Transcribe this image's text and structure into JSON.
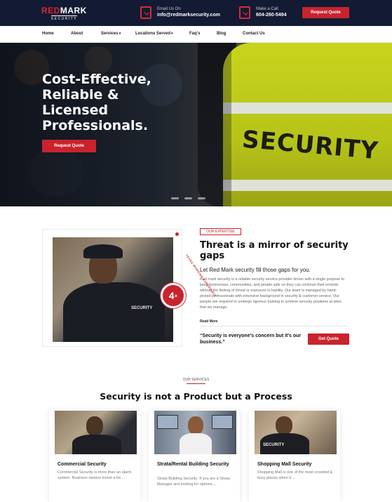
{
  "brand": {
    "name_prefix": "RED",
    "name_suffix": "MARK",
    "tagline": "SECURITY"
  },
  "header": {
    "email_label": "Email Us On",
    "email_value": "info@redmarksecurity.com",
    "call_label": "Make a Call",
    "call_value": "604-260-5494",
    "quote_button": "Request Quote"
  },
  "nav": {
    "items": [
      {
        "label": "Home"
      },
      {
        "label": "About"
      },
      {
        "label": "Services",
        "dropdown": true
      },
      {
        "label": "Locations Served",
        "dropdown": true
      },
      {
        "label": "Faq's"
      },
      {
        "label": "Blog"
      },
      {
        "label": "Contact Us"
      }
    ]
  },
  "hero": {
    "title": "Cost-Effective, Reliable & Licensed Professionals.",
    "button": "Request Quote",
    "image_text": "SECURITY",
    "slides": 3
  },
  "about": {
    "eyebrow": "OUR EXPERTISE",
    "title": "Threat is a mirror of security gaps",
    "subtitle": "Let Red Mark security fill those gaps for you.",
    "body": "Red mark security is a reliable security service provider driven with a single purpose to keep businesses, communities, and people safe so they can continue their errands without the feeling of threat or exposure to liability. Our team is managed by hand-picked professionals with extensive background in security & customer service. Our people are required to undergo rigorous training to achieve security positions at sites that we manage.",
    "read_more": "Read More",
    "quote": "“Security is everyone's concern but it's our business.”",
    "quote_button": "Get Quote",
    "badge_value": "4",
    "badge_sup": "+",
    "badge_ring": "YEARS WORKING EXPERIENCE",
    "image_label": "SECURITY"
  },
  "services": {
    "eyebrow": "OUR SERVICES",
    "title": "Security is not a Product but a Process",
    "cards": [
      {
        "title": "Commercial Security",
        "text": "Commercial Security is more than an alarm system. Business owners invest a lot ..."
      },
      {
        "title": "Strata/Rental Building Security",
        "text": "Strata Building Security: If you are a Strata Manager and looking for options ..."
      },
      {
        "title": "Shopping Mall Security",
        "text": "Shopping Mall is one of the most crowded & busy places when it ...",
        "image_label": "SECURITY"
      }
    ]
  },
  "colors": {
    "accent": "#c9232d",
    "topbar": "#121b33"
  }
}
